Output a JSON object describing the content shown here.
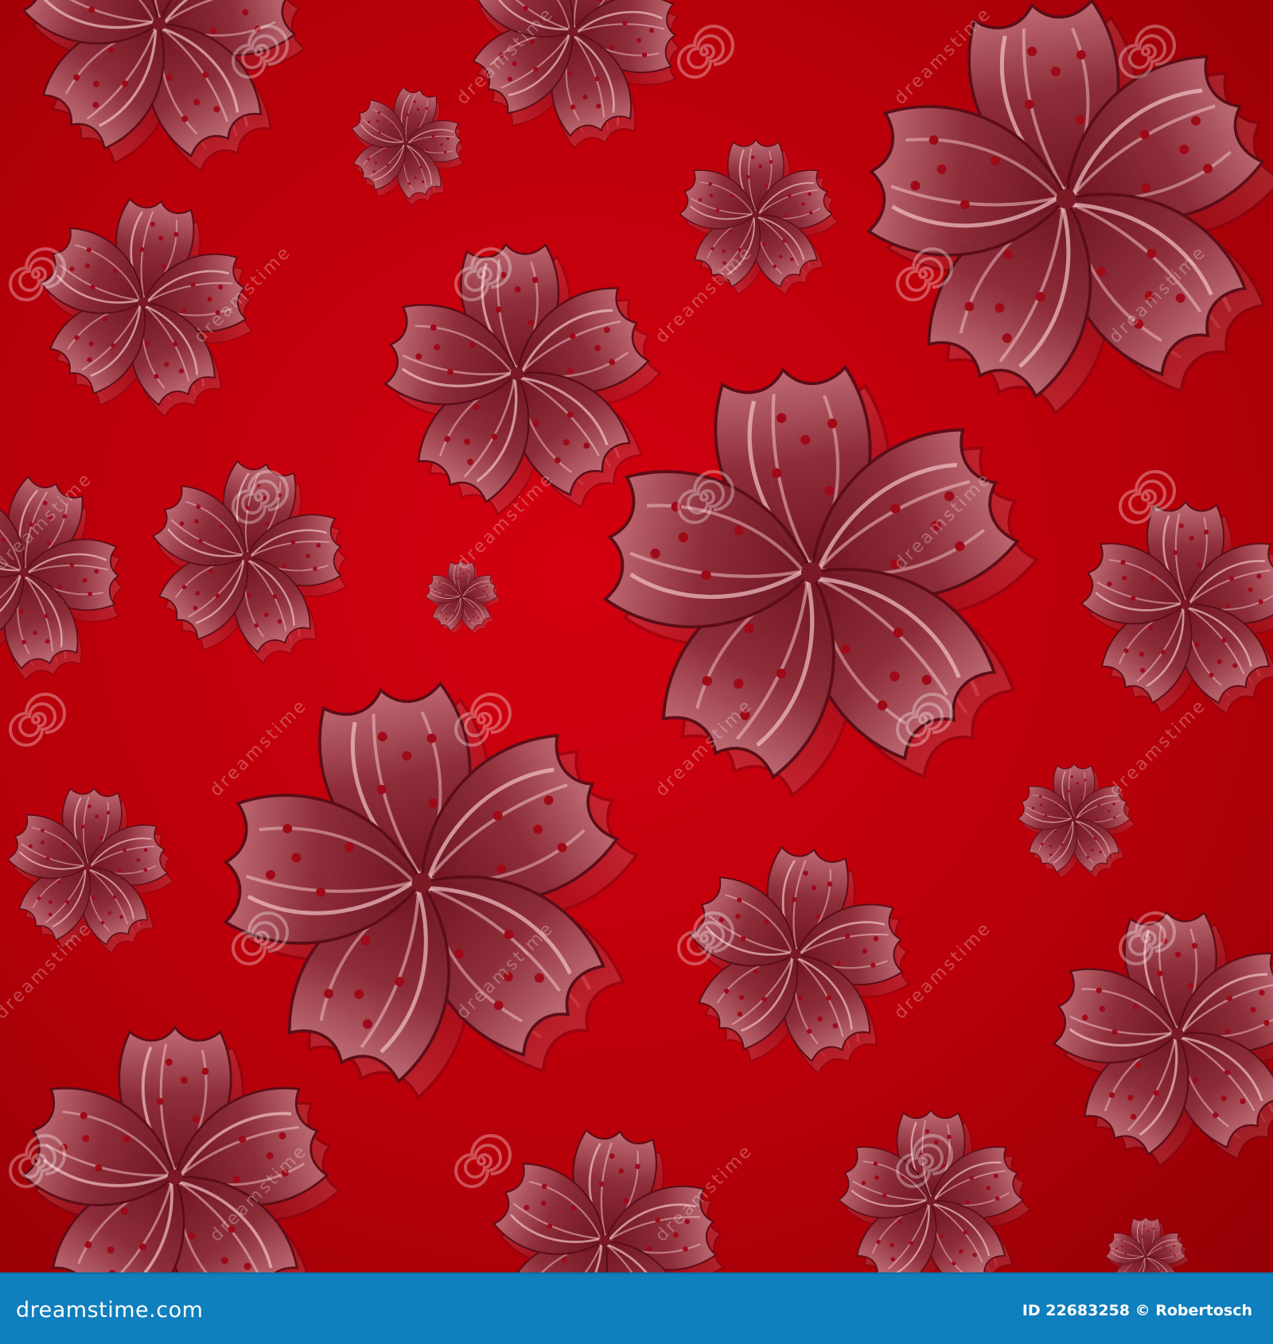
{
  "image": {
    "description": "Seamless red background with stylized dark-pink five-petal flowers",
    "background_color": "#c8000c",
    "flower_color": "#8f3340"
  },
  "watermark": {
    "text": "dreamstime"
  },
  "footer": {
    "site": "dreamstime.com",
    "id_text": "ID 22683258 © Robertosch",
    "background_color": "#0f7fbd"
  }
}
